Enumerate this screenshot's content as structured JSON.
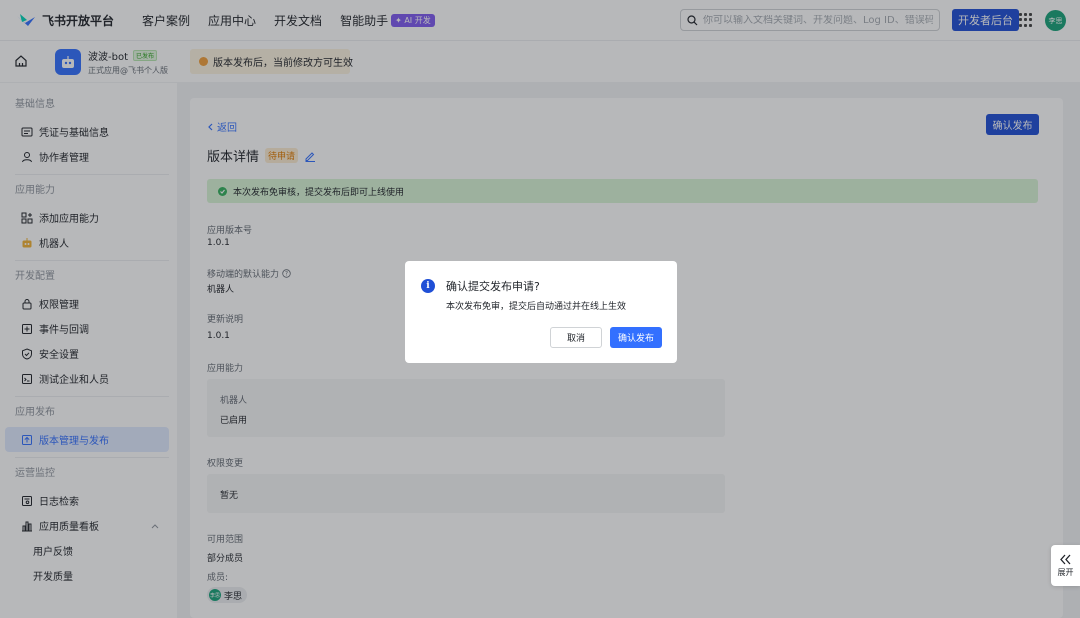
{
  "topbar": {
    "brand": "飞书开放平台",
    "nav": [
      "客户案例",
      "应用中心",
      "开发文档",
      "智能助手"
    ],
    "ai_badge": "✦ AI 开发",
    "search_placeholder": "你可以输入文档关键词、开发问题、Log ID、错误码",
    "dev_console": "开发者后台",
    "user_avatar": "李思"
  },
  "subbar": {
    "app_name": "波波-bot",
    "app_tag": "已发布",
    "app_sub": "正式应用@飞书个人版",
    "notice": "版本发布后，当前修改方可生效"
  },
  "sidebar": {
    "groups": [
      {
        "title": "基础信息",
        "items": [
          {
            "label": "凭证与基础信息",
            "icon": "credential-icon"
          },
          {
            "label": "协作者管理",
            "icon": "user-icon"
          }
        ]
      },
      {
        "title": "应用能力",
        "items": [
          {
            "label": "添加应用能力",
            "icon": "grid-add-icon"
          },
          {
            "label": "机器人",
            "icon": "robot-icon"
          }
        ]
      },
      {
        "title": "开发配置",
        "items": [
          {
            "label": "权限管理",
            "icon": "lock-icon"
          },
          {
            "label": "事件与回调",
            "icon": "event-icon"
          },
          {
            "label": "安全设置",
            "icon": "shield-icon"
          },
          {
            "label": "测试企业和人员",
            "icon": "test-icon"
          }
        ]
      },
      {
        "title": "应用发布",
        "items": [
          {
            "label": "版本管理与发布",
            "icon": "publish-icon",
            "active": true
          }
        ]
      },
      {
        "title": "运营监控",
        "items": [
          {
            "label": "日志检索",
            "icon": "log-icon"
          },
          {
            "label": "应用质量看板",
            "icon": "chart-icon"
          },
          {
            "label": "用户反馈",
            "icon": "",
            "sub": true
          },
          {
            "label": "开发质量",
            "icon": "",
            "sub": true
          }
        ]
      }
    ]
  },
  "main": {
    "back": "返回",
    "confirm_top": "确认发布",
    "title": "版本详情",
    "status_tag": "待申请",
    "success_msg": "本次发布免审核，提交发布后即可上线使用",
    "version_label": "应用版本号",
    "version_value": "1.0.1",
    "mobile_label": "移动端的默认能力",
    "mobile_value": "机器人",
    "update_label": "更新说明",
    "update_value": "1.0.1",
    "cap_label": "应用能力",
    "cap_name": "机器人",
    "cap_status": "已启用",
    "perm_label": "权限变更",
    "perm_value": "暂无",
    "scope_label": "可用范围",
    "scope_value": "部分成员",
    "members_label": "成员:",
    "member_name": "李思",
    "member_avatar": "李思"
  },
  "modal": {
    "title": "确认提交发布申请?",
    "body": "本次发布免审，提交后自动通过并在线上生效",
    "cancel": "取消",
    "confirm": "确认发布"
  },
  "expand": {
    "label": "展开"
  },
  "colors": {
    "primary": "#3370ff",
    "dark_primary": "#1f4fd6",
    "success_bg": "#d9f5d6",
    "warning": "#f2a03b"
  }
}
